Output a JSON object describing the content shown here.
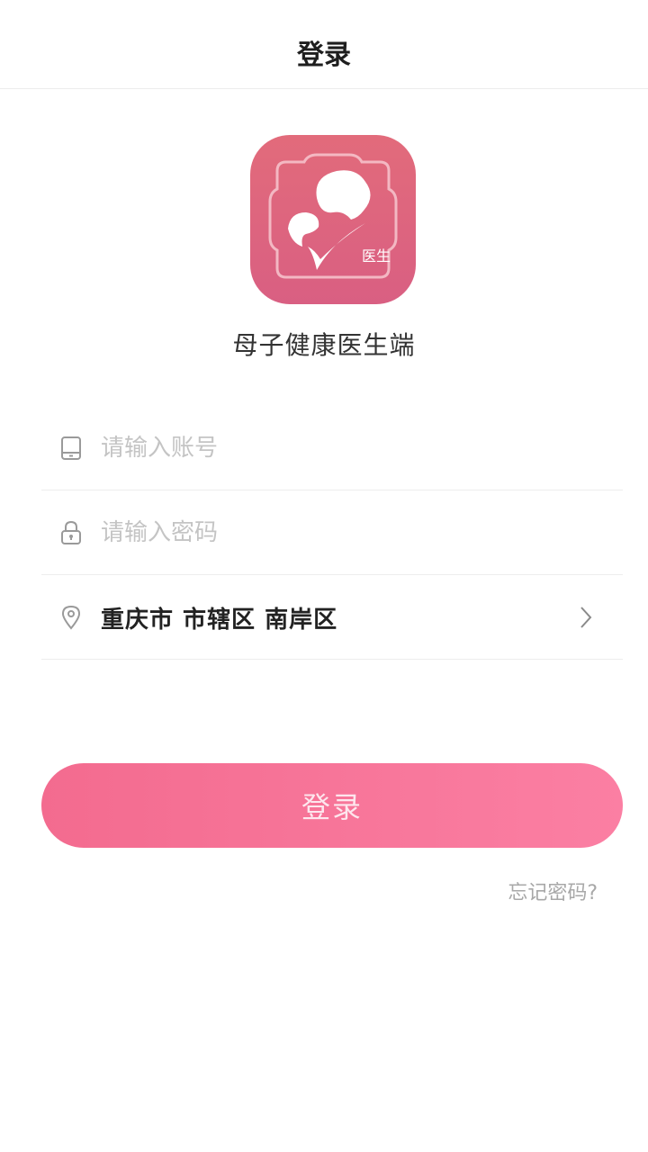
{
  "header": {
    "title": "登录"
  },
  "app": {
    "name": "母子健康医生端",
    "logo_badge": "医生",
    "logo_color": "#dd6580"
  },
  "form": {
    "account_placeholder": "请输入账号",
    "password_placeholder": "请输入密码",
    "region": "重庆市 市辖区 南岸区"
  },
  "actions": {
    "login_label": "登录",
    "forgot_label": "忘记密码?"
  },
  "colors": {
    "accent": "#f7739a",
    "placeholder": "#c4c4c4",
    "divider": "#ededed"
  }
}
